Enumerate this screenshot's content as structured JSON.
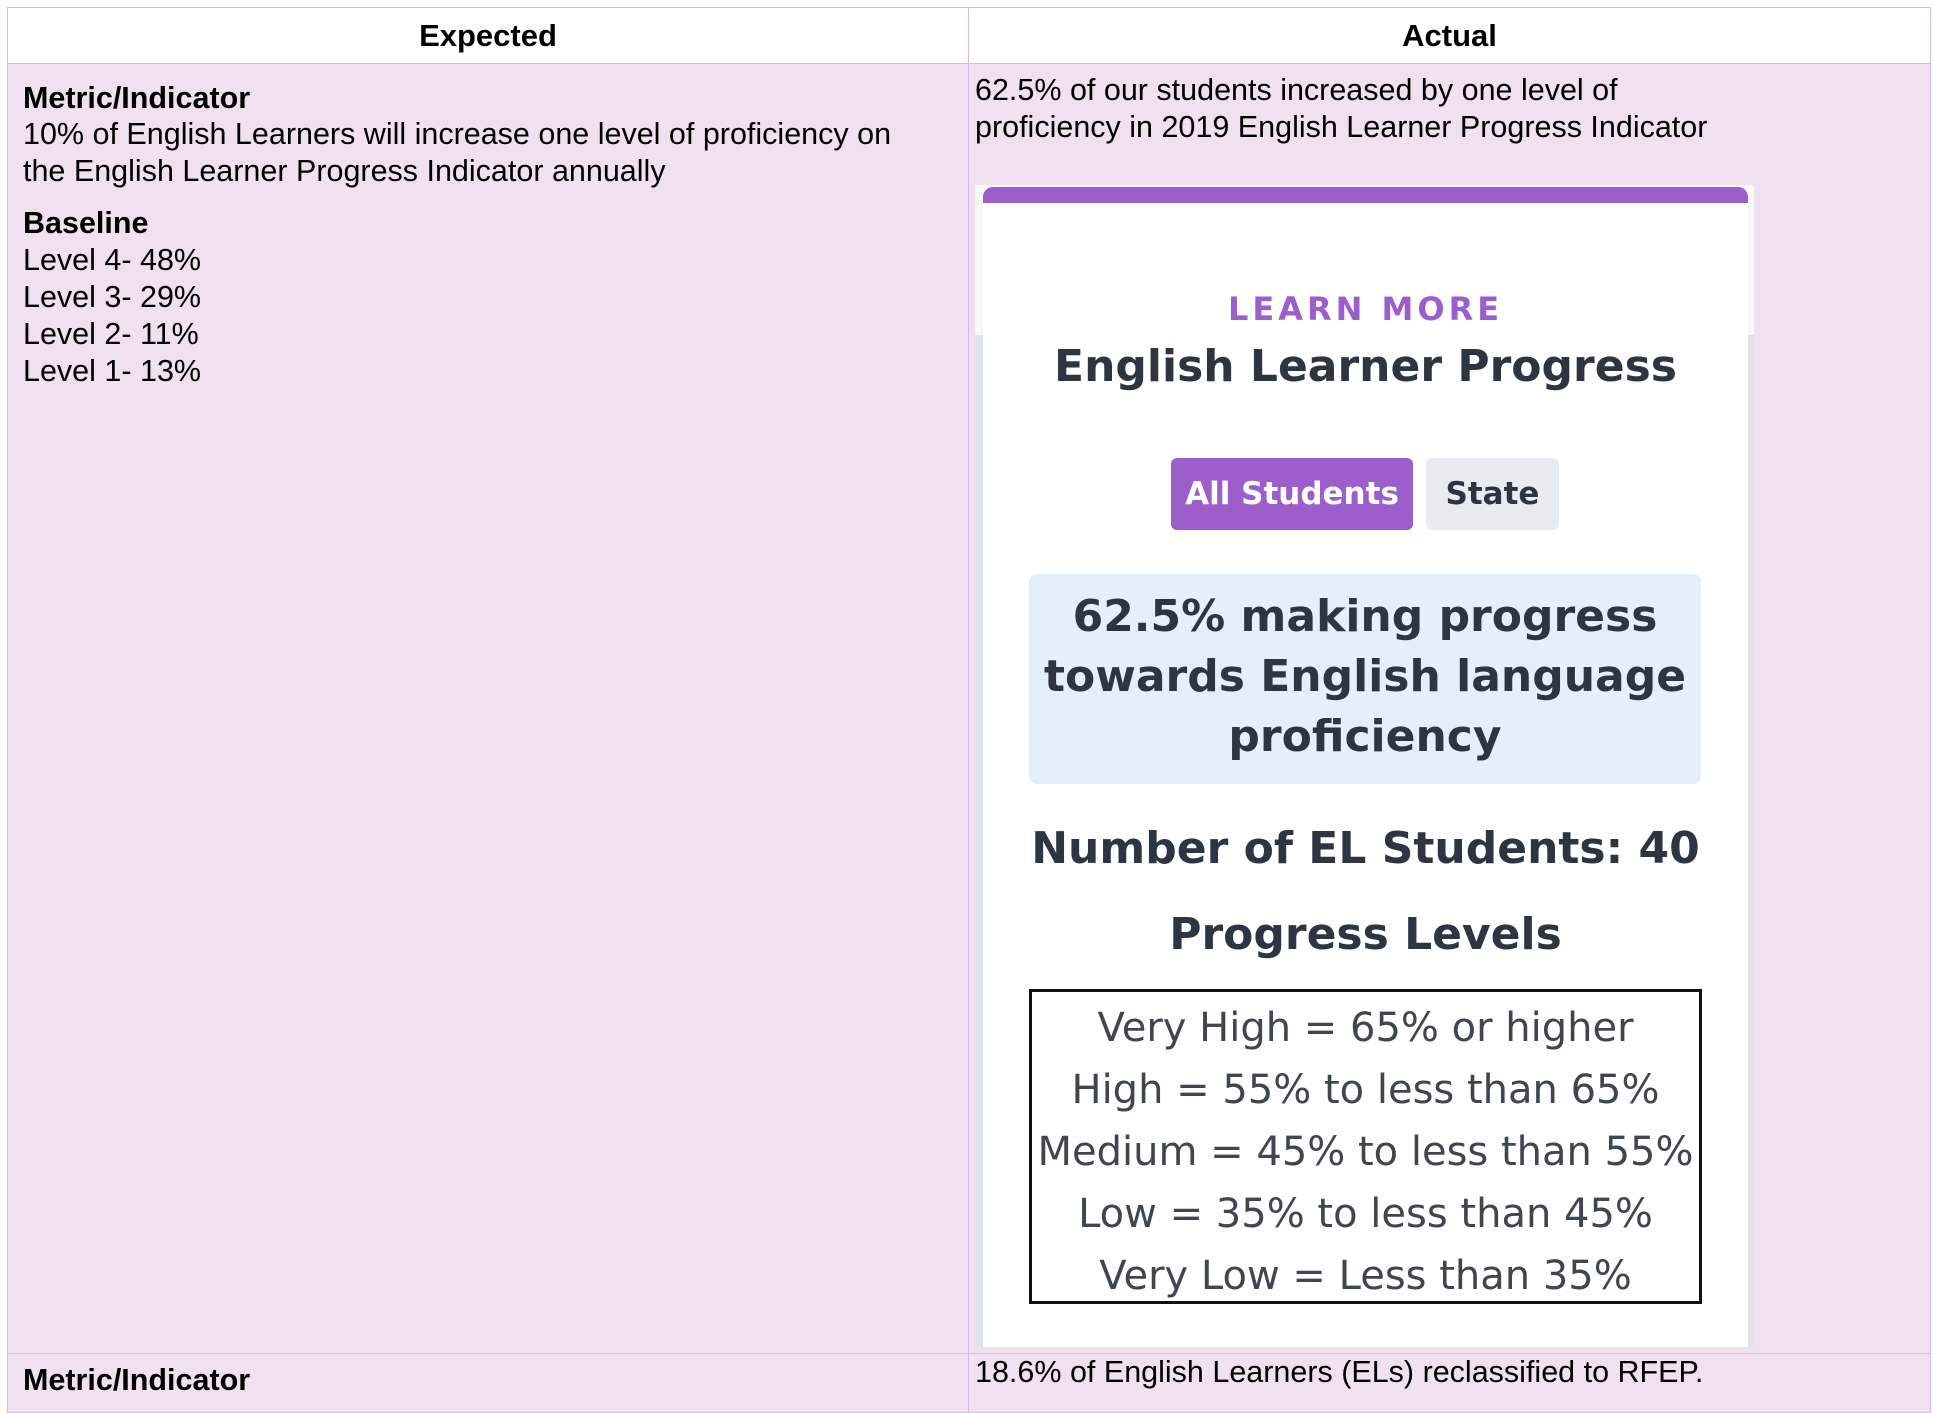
{
  "table": {
    "headers": {
      "expected": "Expected",
      "actual": "Actual"
    },
    "row1": {
      "expected": {
        "metric_heading": "Metric/Indicator",
        "metric_text_line1": "10% of English Learners will increase one level of proficiency on",
        "metric_text_line2": "the English Learner Progress Indicator annually",
        "baseline_heading": "Baseline",
        "baseline_levels": [
          "Level 4- 48%",
          "Level 3- 29%",
          "Level 2- 11%",
          "Level 1- 13%"
        ]
      },
      "actual": {
        "text_line1": "62.5% of our students increased by one level of",
        "text_line2": "proficiency in 2019 English Learner Progress Indicator",
        "card": {
          "eyebrow": "LEARN MORE",
          "title": "English Learner Progress",
          "buttons": {
            "all_students": "All Students",
            "state": "State"
          },
          "progress_lines": [
            "62.5% making progress",
            "towards English language",
            "proficiency"
          ],
          "el_count": "Number of EL Students: 40",
          "levels_title": "Progress Levels",
          "levels": [
            "Very High = 65% or higher",
            "High = 55% to less than 65%",
            "Medium = 45% to less than 55%",
            "Low = 35% to less than 45%",
            "Very Low = Less than 35%"
          ],
          "colors": {
            "accent": "#9b5ecb",
            "progress_bg": "#e3f0fb",
            "text": "#2d3542"
          }
        }
      }
    },
    "row2": {
      "expected": {
        "metric_heading": "Metric/Indicator"
      },
      "actual": {
        "text": "18.6% of English Learners (ELs) reclassified to RFEP."
      }
    },
    "colors": {
      "border": "#d4b8ee",
      "cell_bg": "#f1e1f0"
    }
  }
}
